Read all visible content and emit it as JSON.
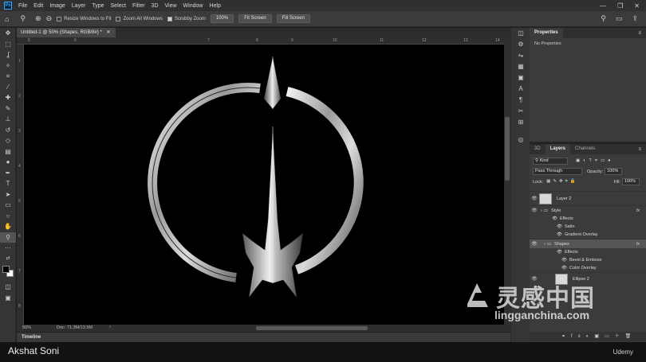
{
  "app": {
    "logo": "Ps",
    "menu": [
      "File",
      "Edit",
      "Image",
      "Layer",
      "Type",
      "Select",
      "Filter",
      "3D",
      "View",
      "Window",
      "Help"
    ],
    "window_controls": [
      "—",
      "❐",
      "✕"
    ]
  },
  "options_bar": {
    "resize_windows": "Resize Windows to Fit",
    "zoom_all": "Zoom All Windows",
    "scrubby_zoom": "Scrubby Zoom",
    "zoom_value": "100%",
    "fit_screen": "Fit Screen",
    "fill_screen": "Fill Screen"
  },
  "document": {
    "tab_title": "Untitled-1 @ 50% (Shapes, RGB/8#) *",
    "ruler_top": [
      "5",
      "6",
      "7",
      "8",
      "9",
      "10",
      "11",
      "12",
      "13",
      "14"
    ],
    "ruler_left": [
      "1",
      "2",
      "3",
      "4",
      "5",
      "6",
      "7",
      "8"
    ]
  },
  "status": {
    "zoom": "50%",
    "doc": "Doc: 71.3M/13.9M"
  },
  "timeline": {
    "label": "Timeline"
  },
  "properties": {
    "tab": "Properties",
    "message": "No Properties"
  },
  "layers_panel": {
    "tabs": [
      "3D",
      "Layers",
      "Channels"
    ],
    "filter_kind": "Kind",
    "blend_mode": "Pass Through",
    "opacity_label": "Opacity:",
    "opacity": "100%",
    "lock_label": "Lock:",
    "fill_label": "Fill:",
    "fill": "100%",
    "layers": [
      {
        "name": "Layer 2",
        "type": "thumb",
        "fx": ""
      },
      {
        "name": "Style",
        "type": "group",
        "fx": "fx"
      },
      {
        "name": "Effects",
        "type": "effects",
        "fx": ""
      },
      {
        "name": "Satin",
        "type": "effect",
        "fx": ""
      },
      {
        "name": "Gradient Overlay",
        "type": "effect",
        "fx": ""
      },
      {
        "name": "Shapes",
        "type": "group",
        "fx": "fx"
      },
      {
        "name": "Effects",
        "type": "effects",
        "fx": ""
      },
      {
        "name": "Bevel & Emboss",
        "type": "effect",
        "fx": ""
      },
      {
        "name": "Color Overlay",
        "type": "effect",
        "fx": ""
      },
      {
        "name": "Ellipse 2",
        "type": "thumb",
        "fx": ""
      }
    ]
  },
  "caption": {
    "author": "Akshat Soni",
    "brand": "Udemy"
  },
  "watermark": {
    "chinese": "灵感中国",
    "domain": "lingganchina.com"
  },
  "colors": {
    "canvas": "#000000",
    "metal_light": "#e6e6e6",
    "metal_dark": "#3a3a3a",
    "ps_blue": "#31a8ff"
  }
}
